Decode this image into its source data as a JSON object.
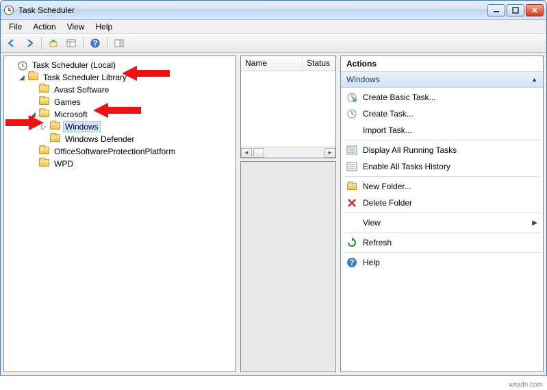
{
  "window": {
    "title": "Task Scheduler"
  },
  "menus": {
    "file": "File",
    "action": "Action",
    "view": "View",
    "help": "Help"
  },
  "tree": {
    "root": "Task Scheduler (Local)",
    "library": "Task Scheduler Library",
    "nodes": {
      "avast": "Avast Software",
      "games": "Games",
      "microsoft": "Microsoft",
      "windows": "Windows",
      "defender": "Windows Defender",
      "ospp": "OfficeSoftwareProtectionPlatform",
      "wpd": "WPD"
    }
  },
  "listColumns": {
    "name": "Name",
    "status": "Status"
  },
  "actionsPane": {
    "title": "Actions",
    "context": "Windows",
    "items": {
      "createBasic": "Create Basic Task...",
      "createTask": "Create Task...",
      "importTask": "Import Task...",
      "displayRunning": "Display All Running Tasks",
      "enableHistory": "Enable All Tasks History",
      "newFolder": "New Folder...",
      "deleteFolder": "Delete Folder",
      "view": "View",
      "refresh": "Refresh",
      "help": "Help"
    }
  },
  "footer": "wsxdn.com"
}
